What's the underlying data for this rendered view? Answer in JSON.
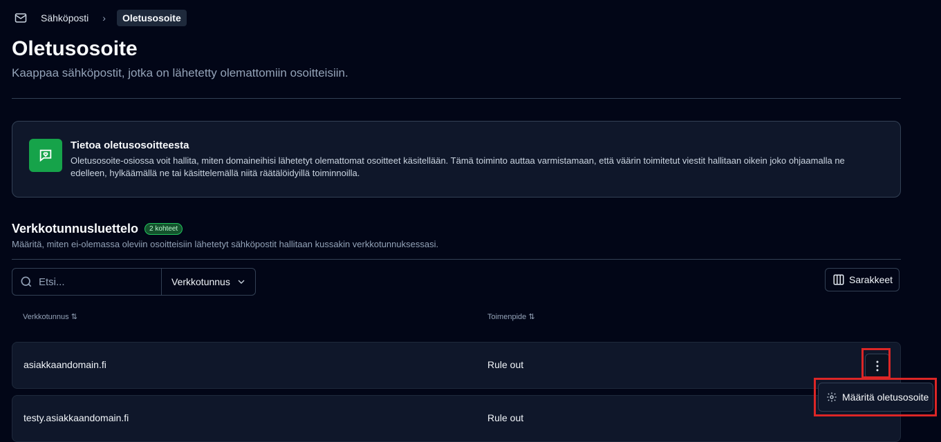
{
  "breadcrumb": {
    "icon": "mail-icon",
    "parent": "Sähköposti",
    "separator": ">",
    "current": "Oletusosoite"
  },
  "header": {
    "title": "Oletusosoite",
    "subtitle": "Kaappaa sähköpostit, jotka on lähetetty olemattomiin osoitteisiin."
  },
  "info": {
    "icon": "message-heart-icon",
    "title": "Tietoa oletusosoitteesta",
    "text": "Oletusosoite-osiossa voit hallita, miten domaineihisi lähetetyt olemattomat osoitteet käsitellään. Tämä toiminto auttaa varmistamaan, että väärin toimitetut viestit hallitaan oikein joko ohjaamalla ne edelleen, hylkäämällä ne tai käsittelemällä niitä räätälöidyillä toiminnoilla."
  },
  "list": {
    "title": "Verkkotunnusluettelo",
    "count": "2 kohteet",
    "subtitle": "Määritä, miten ei-olemassa oleviin osoitteisiin lähetetyt sähköpostit hallitaan kussakin verkkotunnuksessasi."
  },
  "toolbar": {
    "search_placeholder": "Etsi...",
    "filter_label": "Verkkotunnus",
    "columns_label": "Sarakkeet"
  },
  "table": {
    "headers": [
      "Verkkotunnus ⇅",
      "Toimenpide ⇅"
    ],
    "rows": [
      {
        "domain": "asiakkaandomain.fi",
        "action": "Rule out"
      },
      {
        "domain": "testy.asiakkaandomain.fi",
        "action": "Rule out"
      }
    ]
  },
  "menu": {
    "item": "Määritä oletusosoite",
    "icon": "gear-icon"
  },
  "colors": {
    "background": "#020617",
    "accent_green": "#16a34a",
    "highlight": "#dc2626"
  }
}
